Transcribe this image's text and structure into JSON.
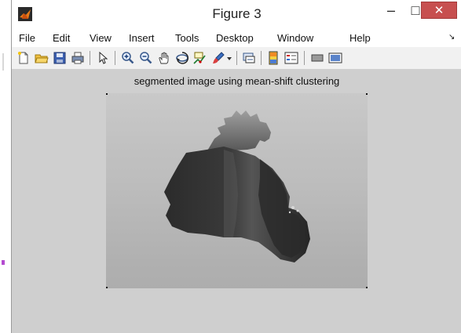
{
  "window": {
    "title": "Figure 3"
  },
  "window_controls": {
    "minimize": "–",
    "maximize": "□",
    "close": "✕"
  },
  "menu": {
    "items": [
      "File",
      "Edit",
      "View",
      "Insert",
      "Tools",
      "Desktop",
      "Window",
      "Help"
    ],
    "overflow": "↘"
  },
  "toolbar": {
    "buttons": [
      "new-figure-icon",
      "open-file-icon",
      "save-icon",
      "print-icon",
      "edit-plot-icon",
      "zoom-in-icon",
      "zoom-out-icon",
      "pan-icon",
      "rotate-3d-icon",
      "data-cursor-icon",
      "brush-icon",
      "link-icon",
      "insert-colorbar-icon",
      "insert-legend-icon",
      "hide-plot-tools-icon",
      "show-plot-tools-icon"
    ]
  },
  "figure": {
    "title": "segmented image using mean-shift clustering"
  },
  "colors": {
    "figure_bg": "#cfcfcf",
    "close_button": "#c74f4f",
    "blob_dark": "#242424",
    "blob_mid": "#4c4c4c"
  }
}
